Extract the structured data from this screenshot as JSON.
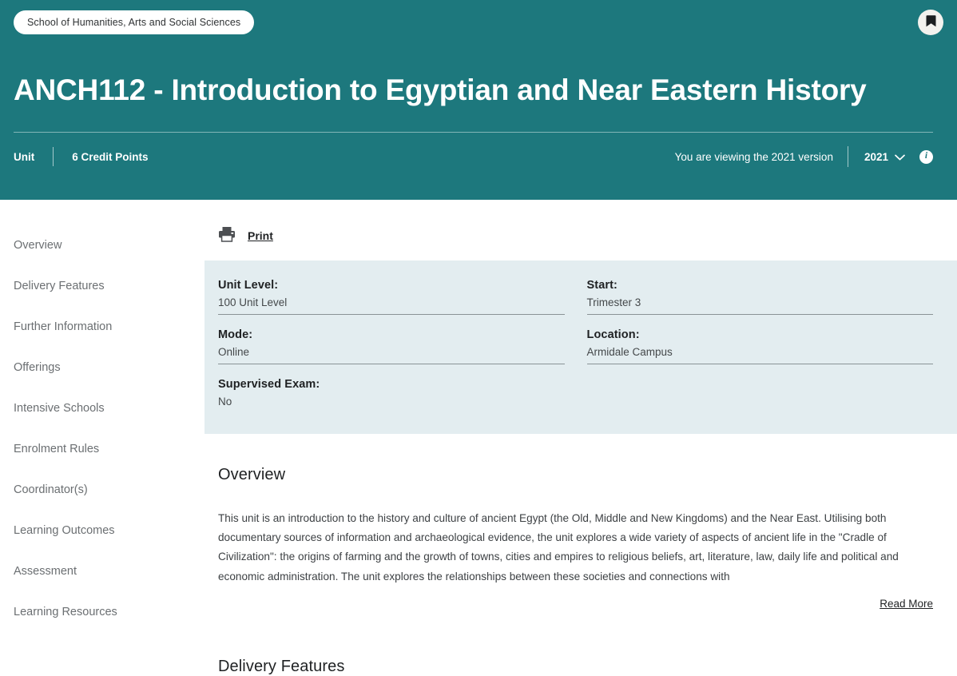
{
  "header": {
    "school_badge": "School of Humanities, Arts and Social Sciences",
    "bookmark_icon": "bookmark-icon",
    "title": "ANCH112 - Introduction to Egyptian and Near Eastern History",
    "unit_type": "Unit",
    "credit_points": "6 Credit Points",
    "version_note": "You are viewing the 2021 version",
    "year_value": "2021",
    "year_options": [
      "2021"
    ],
    "chevron_icon": "chevron-down-icon",
    "info_icon": "info-icon",
    "info_icon_label": "i",
    "accent_color": "#1d787d"
  },
  "sidebar": {
    "items": [
      {
        "label": "Overview"
      },
      {
        "label": "Delivery Features"
      },
      {
        "label": "Further Information"
      },
      {
        "label": "Offerings"
      },
      {
        "label": "Intensive Schools"
      },
      {
        "label": "Enrolment Rules"
      },
      {
        "label": "Coordinator(s)"
      },
      {
        "label": "Learning Outcomes"
      },
      {
        "label": "Assessment"
      },
      {
        "label": "Learning Resources"
      }
    ]
  },
  "toolbar": {
    "print_icon": "printer-icon",
    "print_label": "Print"
  },
  "info_panel": {
    "background_color": "#e3edf0",
    "left": [
      {
        "label": "Unit Level:",
        "value": "100 Unit Level"
      },
      {
        "label": "Mode:",
        "value": "Online"
      },
      {
        "label": "Supervised Exam:",
        "value": "No"
      }
    ],
    "right": [
      {
        "label": "Start:",
        "value": "Trimester 3"
      },
      {
        "label": "Location:",
        "value": "Armidale Campus"
      }
    ]
  },
  "sections": {
    "overview": {
      "title": "Overview",
      "body": "This unit is an introduction to the history and culture of ancient Egypt (the Old, Middle and New Kingdoms) and the Near East. Utilising both documentary sources of information and archaeological evidence, the unit explores a wide variety of aspects of ancient life in the \"Cradle of Civilization\": the origins of farming and the growth of towns, cities and empires to religious beliefs, art, literature, law, daily life and political and economic administration. The unit explores the relationships between these societies and connections with",
      "read_more_label": "Read More"
    },
    "delivery_features": {
      "title": "Delivery Features"
    }
  }
}
